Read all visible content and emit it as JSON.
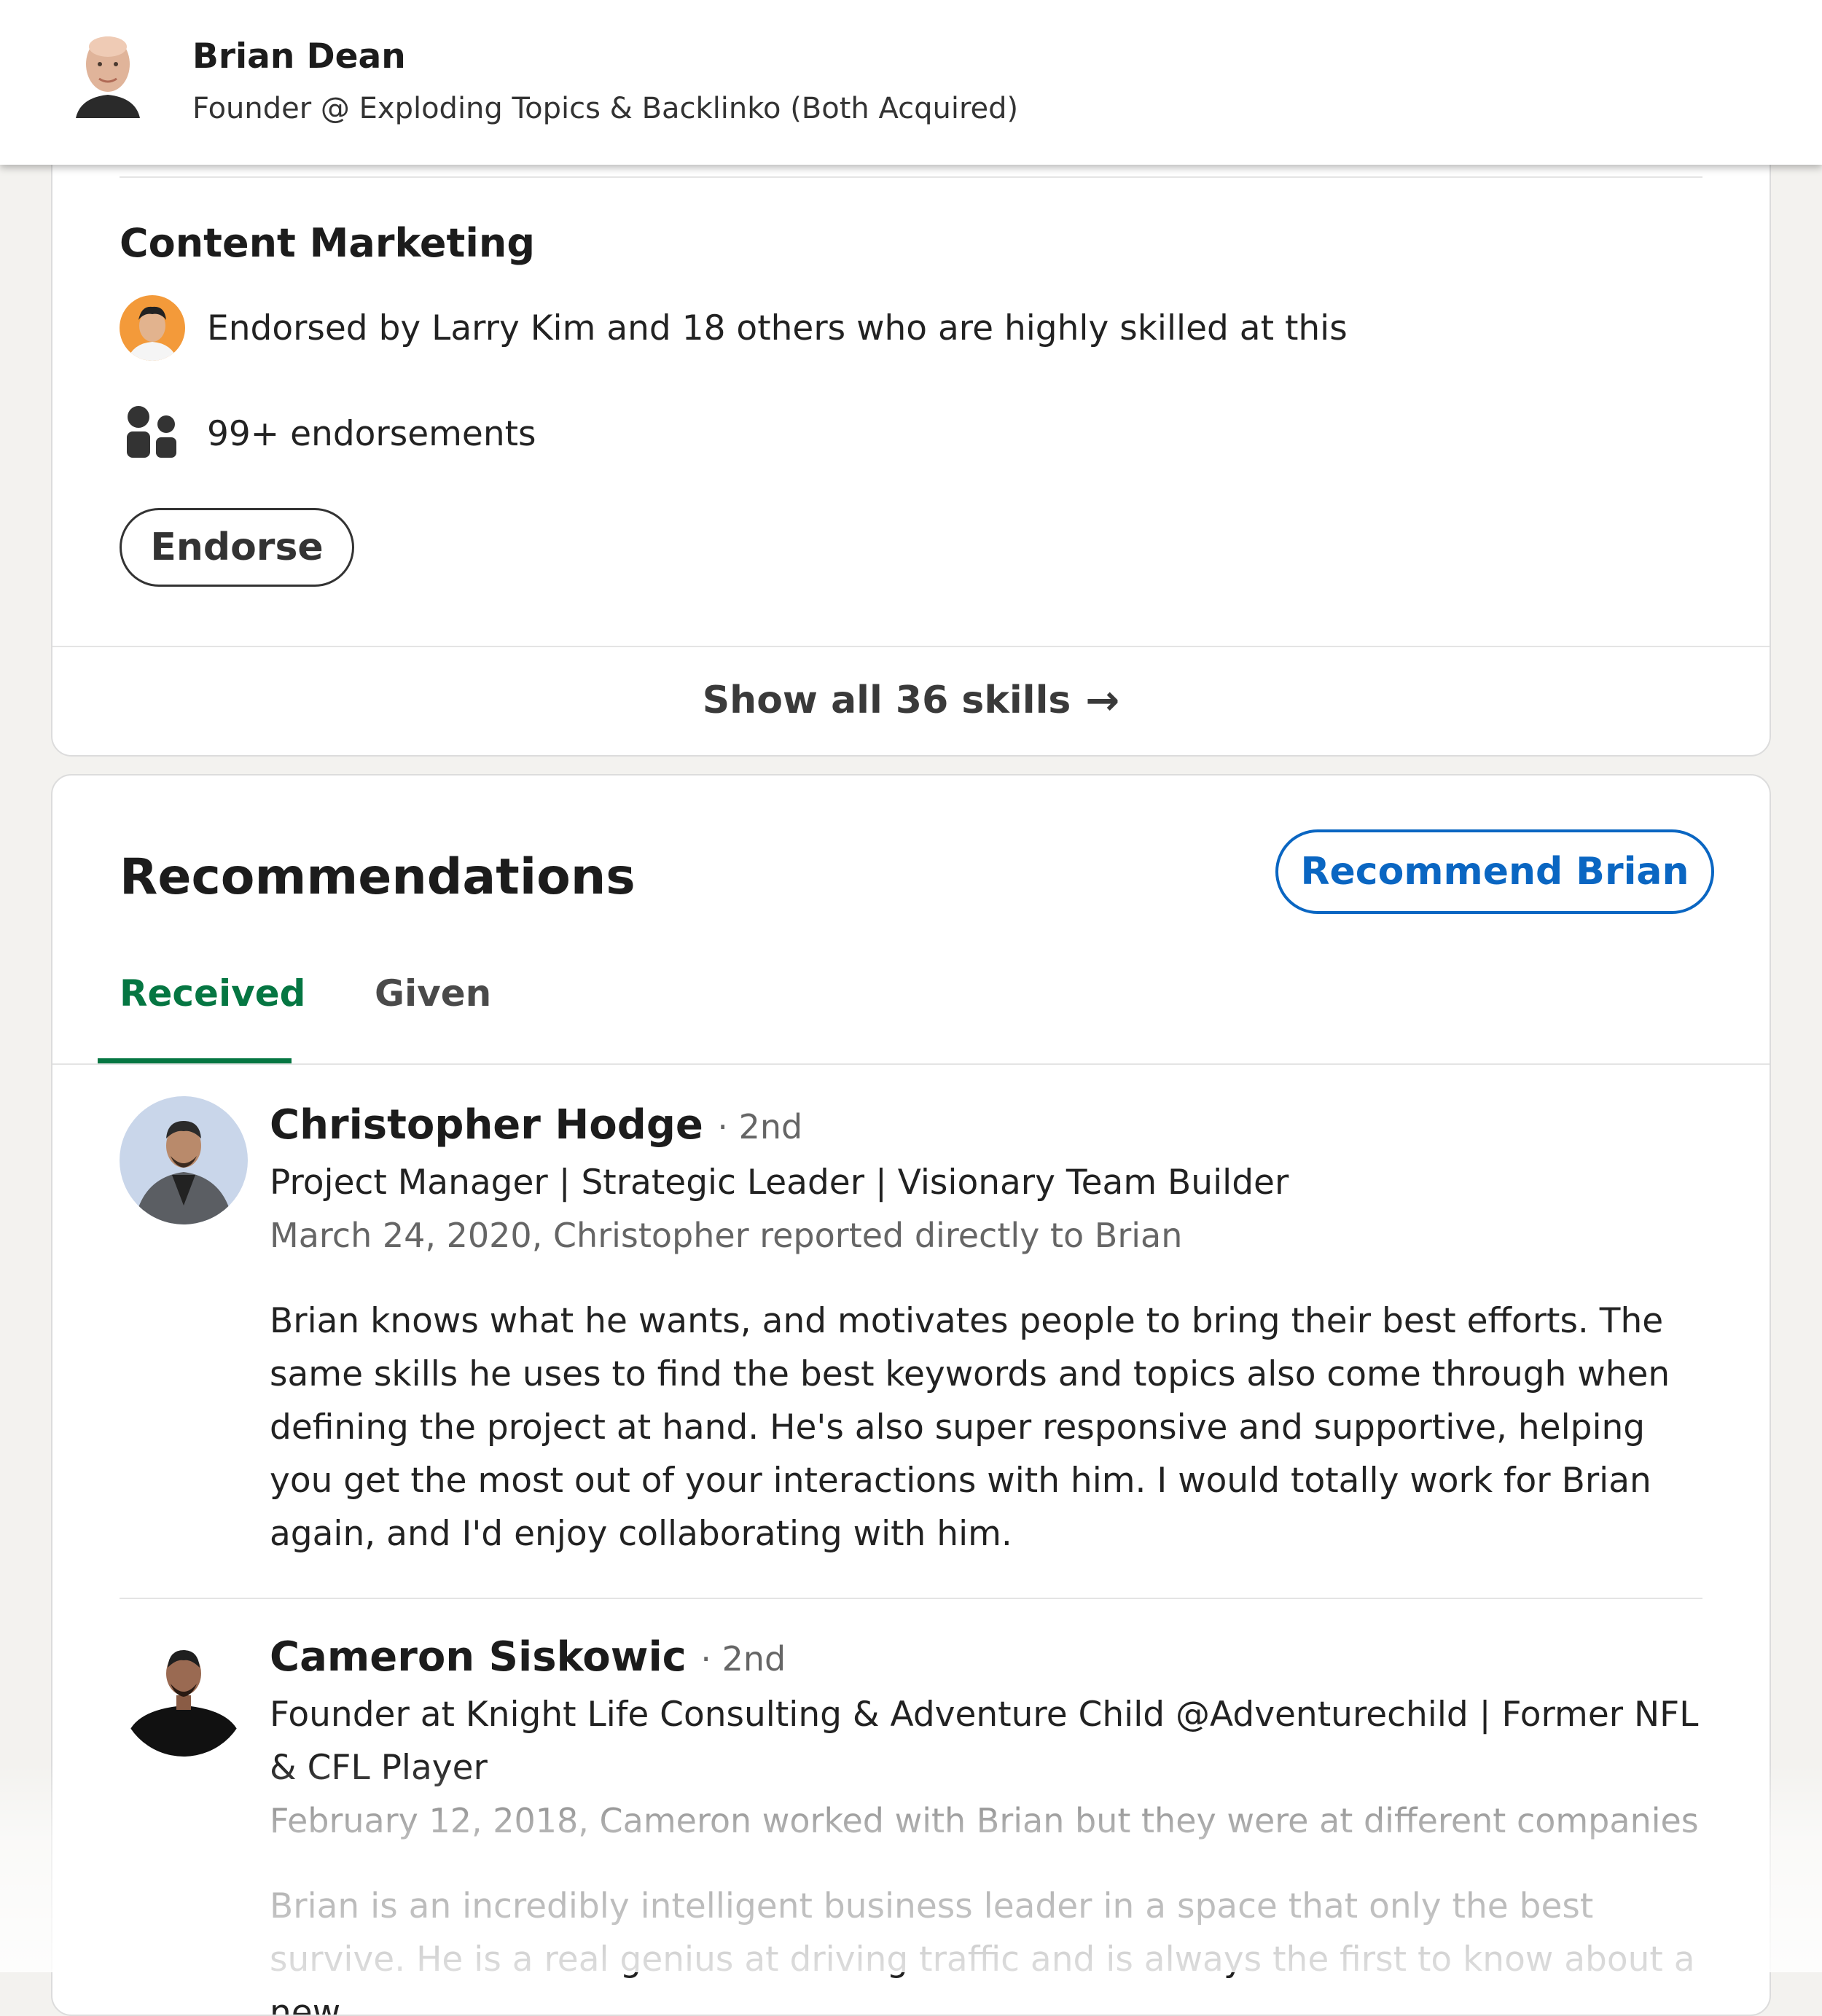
{
  "header": {
    "name": "Brian Dean",
    "headline": "Founder @ Exploding Topics & Backlinko (Both Acquired)"
  },
  "skills": {
    "skill_name": "Content Marketing",
    "endorsed_by": "Endorsed by Larry Kim and 18 others who are highly skilled at this",
    "endorsement_count": "99+ endorsements",
    "endorse_label": "Endorse",
    "show_all_label": "Show all 36 skills",
    "show_all_arrow": "→"
  },
  "recommendations": {
    "title": "Recommendations",
    "recommend_button": "Recommend Brian",
    "tabs": [
      {
        "label": "Received",
        "active": true
      },
      {
        "label": "Given",
        "active": false
      }
    ],
    "items": [
      {
        "name": "Christopher Hodge",
        "degree": "· 2nd",
        "headline": "Project Manager | Strategic Leader | Visionary Team Builder",
        "meta": "March 24, 2020, Christopher reported directly to Brian",
        "text": "Brian knows what he wants, and motivates people to bring their best efforts. The same skills he uses to find the best keywords and topics also come through when defining the project at hand. He's also super responsive and supportive, helping you get the most out of your interactions with him. I would totally work for Brian again, and I'd enjoy collaborating with him."
      },
      {
        "name": "Cameron Siskowic",
        "degree": "· 2nd",
        "headline": "Founder at Knight Life Consulting & Adventure Child @Adventurechild | Former NFL & CFL Player",
        "meta": "February 12, 2018, Cameron worked with Brian but they were at different companies",
        "text": "Brian is an incredibly intelligent business leader in a space that only the best survive. He is a real genius at driving traffic and is always the first to know about a new"
      }
    ]
  },
  "colors": {
    "accent_green": "#057642",
    "link_blue": "#0a66c2",
    "page_bg": "#f3f2ef"
  }
}
